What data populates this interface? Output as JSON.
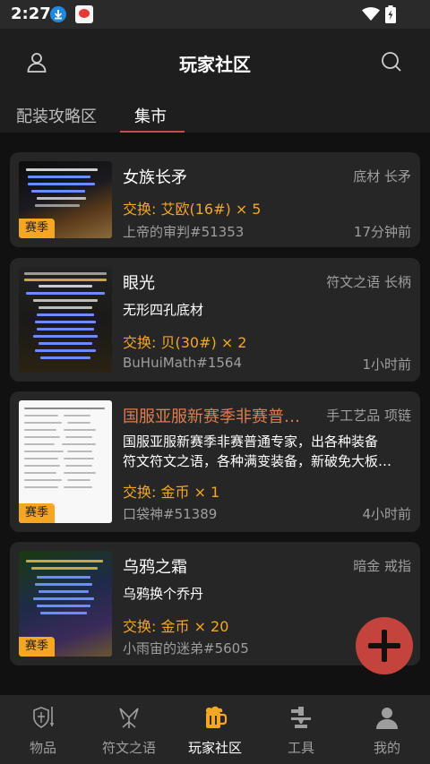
{
  "status_bar": {
    "time": "2:27"
  },
  "header": {
    "title": "玩家社区",
    "tabs": [
      {
        "label": "配装攻略区",
        "active": false
      },
      {
        "label": "集市",
        "active": true
      }
    ]
  },
  "listings": [
    {
      "title": "女族长矛",
      "tag": "底材 长矛",
      "trade": "交换: 艾欧(16#) × 5",
      "user": "上帝的审判#51353",
      "time": "17分钟前",
      "season_badge": "赛季"
    },
    {
      "title": "眼光",
      "tag": "符文之语 长柄",
      "desc": "无形四孔底材",
      "trade": "交换: 贝(30#) × 2",
      "user": "BuHuiMath#1564",
      "time": "1小时前"
    },
    {
      "title": "国服亚服新赛季非赛普…",
      "tag": "手工艺品 项链",
      "desc_line1": "国服亚服新赛季非赛普通专家，出各种装备",
      "desc_line2": "符文符文之语，各种满变装备，新破免大板…",
      "trade": "交换: 金币 × 1",
      "user": "口袋神#51389",
      "time": "4小时前",
      "season_badge": "赛季"
    },
    {
      "title": "乌鸦之霜",
      "tag": "暗金 戒指",
      "desc": "乌鸦换个乔丹",
      "trade": "交换: 金币 × 20",
      "user": "小雨宙的迷弟#5605",
      "time": "1",
      "season_badge": "赛季"
    }
  ],
  "bottom_nav": [
    {
      "label": "物品",
      "icon": "shield-sword-icon",
      "active": false
    },
    {
      "label": "符文之语",
      "icon": "rune-icon",
      "active": false
    },
    {
      "label": "玩家社区",
      "icon": "beer-mug-icon",
      "active": true
    },
    {
      "label": "工具",
      "icon": "anvil-icon",
      "active": false
    },
    {
      "label": "我的",
      "icon": "person-icon",
      "active": false
    }
  ],
  "colors": {
    "accent": "#c0504d",
    "trade": "#f5a623",
    "fab": "#c4433c",
    "title_highlight": "#e07b4f"
  }
}
